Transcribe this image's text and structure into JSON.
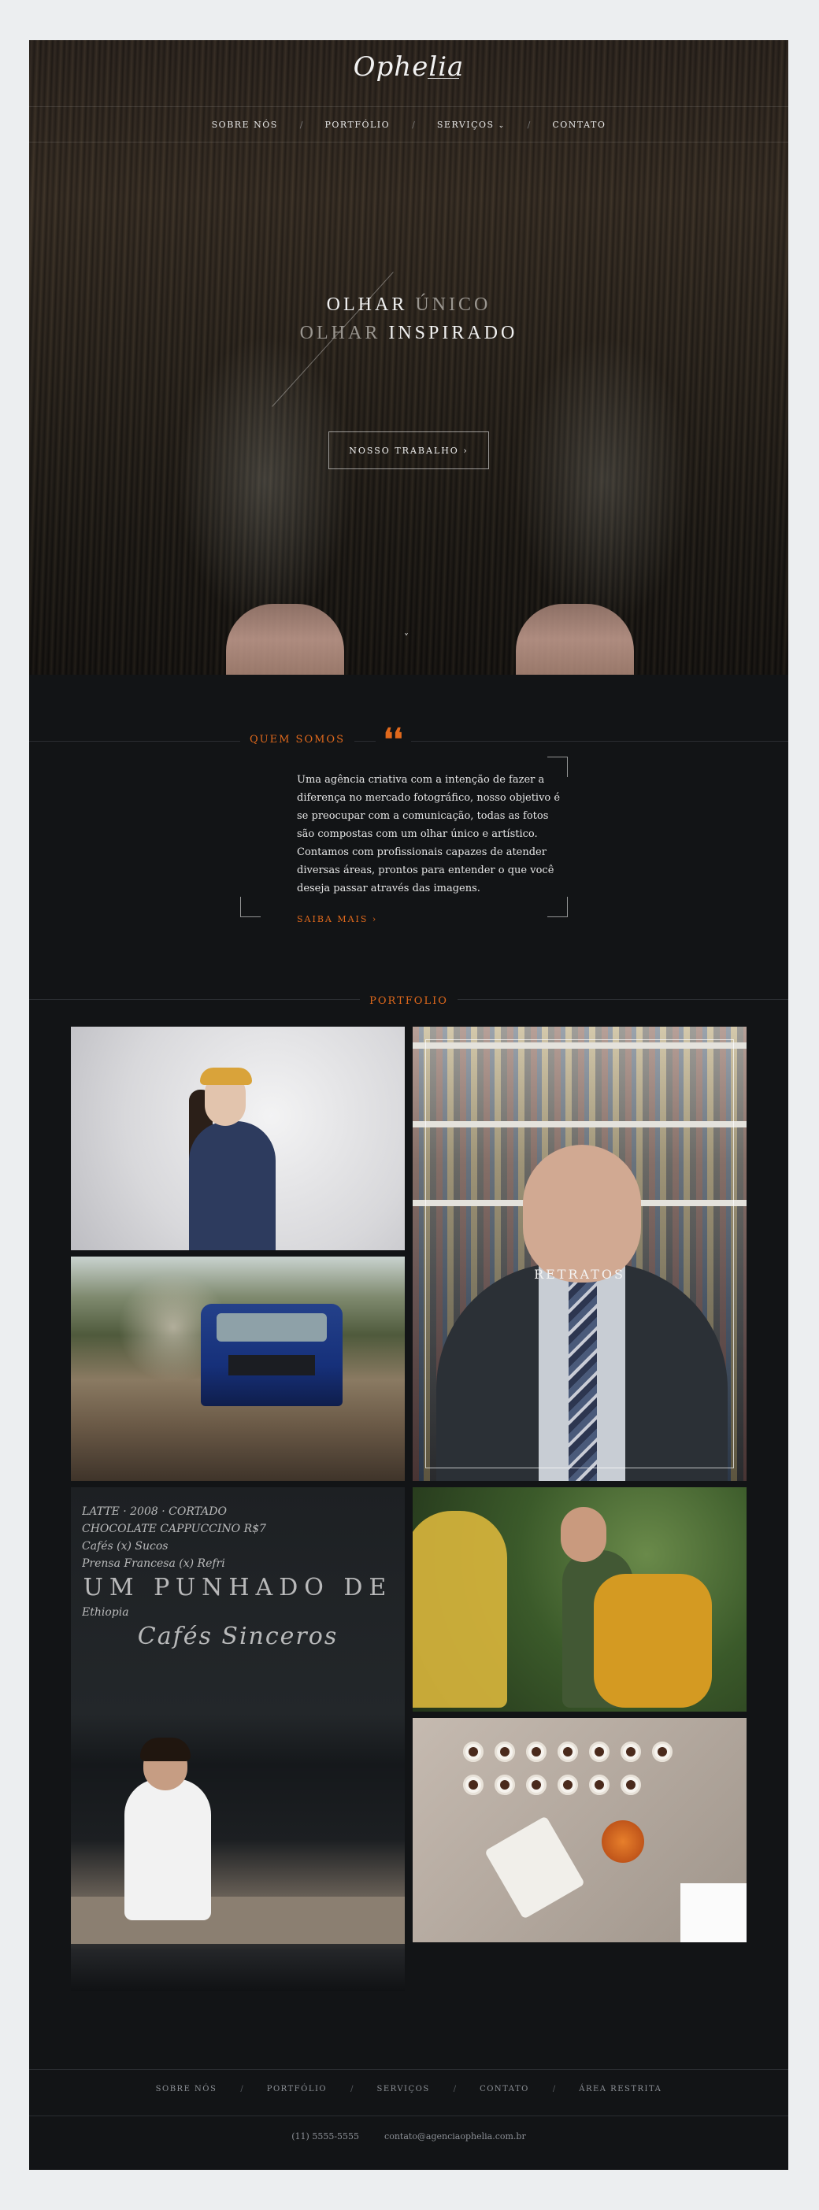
{
  "brand": {
    "logo_text": "Ophelia"
  },
  "nav": {
    "items": [
      "SOBRE NÓS",
      "PORTFÓLIO",
      "SERVIÇOS",
      "CONTATO"
    ],
    "separator": "/",
    "dropdown_indicator": "chevron-down-icon"
  },
  "hero": {
    "line1_a": "OLHAR",
    "line1_b": "ÚNICO",
    "line2_a": "OLHAR",
    "line2_b": "INSPIRADO",
    "button_label": "NOSSO TRABALHO ›",
    "scroll_glyph": "˅"
  },
  "about": {
    "label": "QUEM SOMOS",
    "quote_glyph": "❛❛",
    "text": "Uma agência criativa com a intenção de fazer a diferença no mercado fotográfico, nosso objetivo é se preocupar com a comunicação, todas as fotos são compostas com um olhar único e artístico. Contamos com profissionais capazes de atender diversas áreas, prontos para entender o que você deseja passar através das imagens.",
    "more_label": "SAIBA MAIS ›"
  },
  "portfolio": {
    "label": "PORTFOLIO",
    "featured_label": "RETRATOS",
    "chalk_lines": [
      "LATTE · 2008  ·  CORTADO",
      "CHOCOLATE  CAPPUCCINO  R$7",
      "Cafés  (x)    Sucos",
      "Prensa Francesa (x)   Refri",
      "UM PUNHADO DE",
      "Ethiopia",
      "Cafés Sinceros"
    ]
  },
  "footer": {
    "nav": [
      "SOBRE NÓS",
      "PORTFÓLIO",
      "SERVIÇOS",
      "CONTATO",
      "ÁREA RESTRITA"
    ],
    "separator": "/",
    "phone": "(11) 5555-5555",
    "email": "contato@agenciaophelia.com.br"
  },
  "colors": {
    "accent": "#e0691c",
    "page_bg": "#121416",
    "outer_bg": "#eceef0"
  }
}
